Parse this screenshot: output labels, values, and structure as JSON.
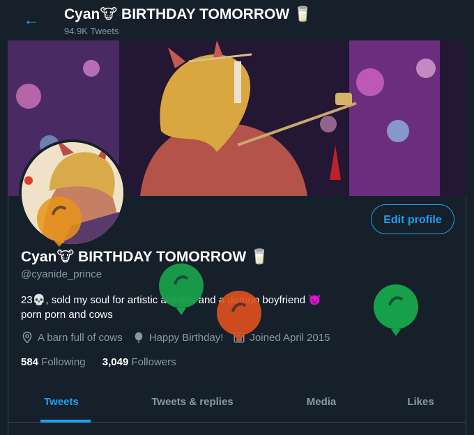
{
  "header": {
    "back_icon": "arrow-left-icon",
    "title": "Cyan🐮 BIRTHDAY TOMORROW 🥛",
    "tweet_count": "94.9K Tweets"
  },
  "profile": {
    "display_name": "Cyan🐮 BIRTHDAY TOMORROW 🥛",
    "handle": "@cyanide_prince",
    "bio_line1": "23💀, sold my soul for artistic abilities and a demon boyfriend 👿",
    "bio_line2": "porn porn and cows",
    "location": "A barn full of cows",
    "birthday": "Happy Birthday!",
    "joined": "Joined April 2015",
    "following_count": "584",
    "following_label": "Following",
    "followers_count": "3,049",
    "followers_label": "Followers",
    "edit_button": "Edit profile"
  },
  "tabs": [
    {
      "label": "Tweets",
      "active": true
    },
    {
      "label": "Tweets & replies",
      "active": false
    },
    {
      "label": "Media",
      "active": false
    },
    {
      "label": "Likes",
      "active": false
    }
  ],
  "colors": {
    "accent": "#1da1f2",
    "background": "#15202b",
    "secondary_text": "#8899a6",
    "balloon_orange": "#e8941a",
    "balloon_green": "#17a04a",
    "balloon_red": "#e0501e"
  }
}
